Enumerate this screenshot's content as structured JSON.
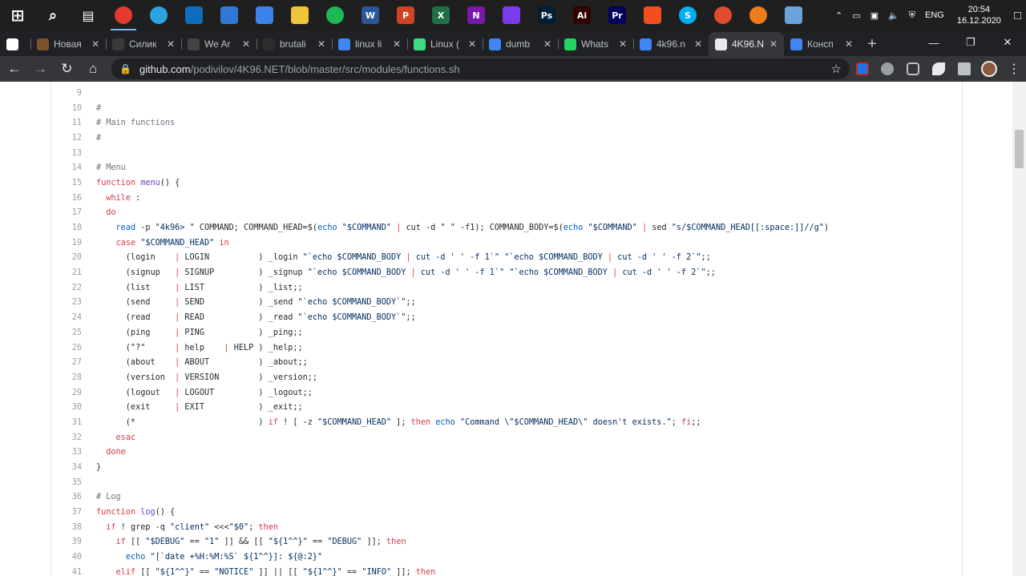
{
  "taskbar": {
    "icons": [
      {
        "name": "windows-start-icon",
        "label": "",
        "color": "#1f1f1f"
      },
      {
        "name": "search-icon",
        "label": "",
        "color": "#1f1f1f"
      },
      {
        "name": "task-view-icon",
        "label": "",
        "color": "#1f1f1f"
      },
      {
        "name": "chrome-icon",
        "label": "",
        "color": "#e33b2e",
        "active": true
      },
      {
        "name": "telegram-icon",
        "label": "",
        "color": "#2aa3df"
      },
      {
        "name": "outlook-icon",
        "label": "",
        "color": "#0f6cbd"
      },
      {
        "name": "calendar-icon",
        "label": "",
        "color": "#2f78d6"
      },
      {
        "name": "todo-icon",
        "label": "",
        "color": "#3c82e8"
      },
      {
        "name": "file-explorer-icon",
        "label": "",
        "color": "#f0c43a"
      },
      {
        "name": "spotify-icon",
        "label": "",
        "color": "#1db954"
      },
      {
        "name": "word-icon",
        "label": "W",
        "color": "#2b579a"
      },
      {
        "name": "powerpoint-icon",
        "label": "P",
        "color": "#d04423"
      },
      {
        "name": "excel-icon",
        "label": "X",
        "color": "#1e7145"
      },
      {
        "name": "onenote-icon",
        "label": "N",
        "color": "#7719aa"
      },
      {
        "name": "obsidian-icon",
        "label": "",
        "color": "#7c3aed"
      },
      {
        "name": "photoshop-icon",
        "label": "Ps",
        "color": "#001e36"
      },
      {
        "name": "illustrator-icon",
        "label": "Ai",
        "color": "#330000"
      },
      {
        "name": "premiere-icon",
        "label": "Pr",
        "color": "#00005b"
      },
      {
        "name": "figma-icon",
        "label": "",
        "color": "#f24e1e"
      },
      {
        "name": "skype-icon",
        "label": "S",
        "color": "#00aff0"
      },
      {
        "name": "app-icon",
        "label": "",
        "color": "#e04b2d"
      },
      {
        "name": "fl-studio-icon",
        "label": "",
        "color": "#f07b1a"
      },
      {
        "name": "notes-app-icon",
        "label": "",
        "color": "#6aa3d9"
      }
    ],
    "language": "ENG",
    "time": "20:54",
    "date": "16.12.2020"
  },
  "tabs": [
    {
      "title": "",
      "favicon": "#fff",
      "active": false
    },
    {
      "title": "Новая",
      "favicon": "#7a5230",
      "active": false
    },
    {
      "title": "Силик",
      "favicon": "#3a3a3a",
      "active": false
    },
    {
      "title": "We Ar",
      "favicon": "#444",
      "active": false
    },
    {
      "title": "brutali",
      "favicon": "#2d2d2d",
      "active": false
    },
    {
      "title": "linux li",
      "favicon": "#4285f4",
      "active": false
    },
    {
      "title": "Linux (",
      "favicon": "#3ddc84",
      "active": false
    },
    {
      "title": "dumb",
      "favicon": "#4285f4",
      "active": false
    },
    {
      "title": "Whats",
      "favicon": "#25d366",
      "active": false
    },
    {
      "title": "4k96.n",
      "favicon": "#4285f4",
      "active": false
    },
    {
      "title": "4K96.N",
      "favicon": "#e8eaed",
      "active": true
    },
    {
      "title": "Консп",
      "favicon": "#4285f4",
      "active": false
    }
  ],
  "omnibox": {
    "host": "github.com",
    "path": "/podivilov/4K96.NET/blob/master/src/modules/functions.sh"
  },
  "code": {
    "lines": [
      {
        "n": "9",
        "t": []
      },
      {
        "n": "10",
        "t": [
          [
            "c",
            "#"
          ]
        ]
      },
      {
        "n": "11",
        "t": [
          [
            "c",
            "# Main functions"
          ]
        ]
      },
      {
        "n": "12",
        "t": [
          [
            "c",
            "#"
          ]
        ]
      },
      {
        "n": "13",
        "t": []
      },
      {
        "n": "14",
        "t": [
          [
            "c",
            "# Menu"
          ]
        ]
      },
      {
        "n": "15",
        "t": [
          [
            "k",
            "function"
          ],
          [
            "",
            " "
          ],
          [
            "f",
            "menu"
          ],
          [
            "",
            "() {"
          ]
        ]
      },
      {
        "n": "16",
        "t": [
          [
            "",
            "  "
          ],
          [
            "k",
            "while"
          ],
          [
            "",
            " :"
          ]
        ]
      },
      {
        "n": "17",
        "t": [
          [
            "",
            "  "
          ],
          [
            "k",
            "do"
          ]
        ]
      },
      {
        "n": "18",
        "t": [
          [
            "",
            "    "
          ],
          [
            "b",
            "read"
          ],
          [
            "",
            " -p "
          ],
          [
            "s",
            "\"4k96> \" "
          ],
          [
            "",
            "COMMAND; COMMAND_HEAD=$("
          ],
          [
            "b",
            "echo"
          ],
          [
            "",
            " "
          ],
          [
            "s",
            "\"$COMMAND\""
          ],
          [
            "",
            " "
          ],
          [
            "k",
            "|"
          ],
          [
            "",
            " cut -d "
          ],
          [
            "s",
            "\" \""
          ],
          [
            "",
            " -f1); COMMAND_BODY=$("
          ],
          [
            "b",
            "echo"
          ],
          [
            "",
            " "
          ],
          [
            "s",
            "\"$COMMAND\""
          ],
          [
            "",
            " "
          ],
          [
            "k",
            "|"
          ],
          [
            "",
            " sed "
          ],
          [
            "s",
            "\"s/$COMMAND_HEAD[[:space:]]//g\""
          ],
          [
            "",
            ")"
          ]
        ]
      },
      {
        "n": "19",
        "t": [
          [
            "",
            "    "
          ],
          [
            "k",
            "case"
          ],
          [
            "",
            " "
          ],
          [
            "s",
            "\"$COMMAND_HEAD\""
          ],
          [
            "",
            " "
          ],
          [
            "k",
            "in"
          ]
        ]
      },
      {
        "n": "20",
        "t": [
          [
            "",
            "      (login    "
          ],
          [
            "k",
            "|"
          ],
          [
            "",
            " LOGIN          ) _login "
          ],
          [
            "s",
            "\"`echo $COMMAND_BODY "
          ],
          [
            "k",
            "|"
          ],
          [
            "s",
            " cut -d ' ' -f 1`\" \"`echo $COMMAND_BODY "
          ],
          [
            "k",
            "|"
          ],
          [
            "s",
            " cut -d ' ' -f 2`\""
          ],
          [
            "",
            ";;"
          ]
        ]
      },
      {
        "n": "21",
        "t": [
          [
            "",
            "      (signup   "
          ],
          [
            "k",
            "|"
          ],
          [
            "",
            " SIGNUP         ) _signup "
          ],
          [
            "s",
            "\"`echo $COMMAND_BODY "
          ],
          [
            "k",
            "|"
          ],
          [
            "s",
            " cut -d ' ' -f 1`\" \"`echo $COMMAND_BODY "
          ],
          [
            "k",
            "|"
          ],
          [
            "s",
            " cut -d ' ' -f 2`\""
          ],
          [
            "",
            ";;"
          ]
        ]
      },
      {
        "n": "22",
        "t": [
          [
            "",
            "      (list     "
          ],
          [
            "k",
            "|"
          ],
          [
            "",
            " LIST           ) _list;;"
          ]
        ]
      },
      {
        "n": "23",
        "t": [
          [
            "",
            "      (send     "
          ],
          [
            "k",
            "|"
          ],
          [
            "",
            " SEND           ) _send "
          ],
          [
            "s",
            "\"`echo $COMMAND_BODY`\""
          ],
          [
            "",
            ";;"
          ]
        ]
      },
      {
        "n": "24",
        "t": [
          [
            "",
            "      (read     "
          ],
          [
            "k",
            "|"
          ],
          [
            "",
            " READ           ) _read "
          ],
          [
            "s",
            "\"`echo $COMMAND_BODY`\""
          ],
          [
            "",
            ";;"
          ]
        ]
      },
      {
        "n": "25",
        "t": [
          [
            "",
            "      (ping     "
          ],
          [
            "k",
            "|"
          ],
          [
            "",
            " PING           ) _ping;;"
          ]
        ]
      },
      {
        "n": "26",
        "t": [
          [
            "",
            "      (\"?\"      "
          ],
          [
            "k",
            "|"
          ],
          [
            "",
            " help    "
          ],
          [
            "k",
            "|"
          ],
          [
            "",
            " HELP ) _help;;"
          ]
        ]
      },
      {
        "n": "27",
        "t": [
          [
            "",
            "      (about    "
          ],
          [
            "k",
            "|"
          ],
          [
            "",
            " ABOUT          ) _about;;"
          ]
        ]
      },
      {
        "n": "28",
        "t": [
          [
            "",
            "      (version  "
          ],
          [
            "k",
            "|"
          ],
          [
            "",
            " VERSION        ) _version;;"
          ]
        ]
      },
      {
        "n": "29",
        "t": [
          [
            "",
            "      (logout   "
          ],
          [
            "k",
            "|"
          ],
          [
            "",
            " LOGOUT         ) _logout;;"
          ]
        ]
      },
      {
        "n": "30",
        "t": [
          [
            "",
            "      (exit     "
          ],
          [
            "k",
            "|"
          ],
          [
            "",
            " EXIT           ) _exit;;"
          ]
        ]
      },
      {
        "n": "31",
        "t": [
          [
            "",
            "      (*                         ) "
          ],
          [
            "k",
            "if"
          ],
          [
            "",
            " ! [ -z "
          ],
          [
            "s",
            "\"$COMMAND_HEAD\""
          ],
          [
            "",
            " ]; "
          ],
          [
            "k",
            "then"
          ],
          [
            "",
            " "
          ],
          [
            "b",
            "echo"
          ],
          [
            "",
            " "
          ],
          [
            "s",
            "\"Command \\\"$COMMAND_HEAD\\\" doesn't exists.\""
          ],
          [
            "",
            "; "
          ],
          [
            "k",
            "fi"
          ],
          [
            "",
            ";;"
          ]
        ]
      },
      {
        "n": "32",
        "t": [
          [
            "",
            "    "
          ],
          [
            "k",
            "esac"
          ]
        ]
      },
      {
        "n": "33",
        "t": [
          [
            "",
            "  "
          ],
          [
            "k",
            "done"
          ]
        ]
      },
      {
        "n": "34",
        "t": [
          [
            "",
            "}"
          ]
        ]
      },
      {
        "n": "35",
        "t": []
      },
      {
        "n": "36",
        "t": [
          [
            "c",
            "# Log"
          ]
        ]
      },
      {
        "n": "37",
        "t": [
          [
            "k",
            "function"
          ],
          [
            "",
            " "
          ],
          [
            "f",
            "log"
          ],
          [
            "",
            "() {"
          ]
        ]
      },
      {
        "n": "38",
        "t": [
          [
            "",
            "  "
          ],
          [
            "k",
            "if"
          ],
          [
            "",
            " ! grep -q "
          ],
          [
            "s",
            "\"client\""
          ],
          [
            "",
            " <<<"
          ],
          [
            "s",
            "\"$0\""
          ],
          [
            "",
            "; "
          ],
          [
            "k",
            "then"
          ]
        ]
      },
      {
        "n": "39",
        "t": [
          [
            "",
            "    "
          ],
          [
            "k",
            "if"
          ],
          [
            "",
            " [[ "
          ],
          [
            "s",
            "\"$DEBUG\""
          ],
          [
            "",
            " == "
          ],
          [
            "s",
            "\"1\""
          ],
          [
            "",
            " ]] && [[ "
          ],
          [
            "s",
            "\"${1^^}\""
          ],
          [
            "",
            " == "
          ],
          [
            "s",
            "\"DEBUG\""
          ],
          [
            "",
            " ]]; "
          ],
          [
            "k",
            "then"
          ]
        ]
      },
      {
        "n": "40",
        "t": [
          [
            "",
            "      "
          ],
          [
            "b",
            "echo"
          ],
          [
            "",
            " "
          ],
          [
            "s",
            "\"[`date +%H:%M:%S` ${1^^}]: ${@:2}\""
          ]
        ]
      },
      {
        "n": "41",
        "t": [
          [
            "",
            "    "
          ],
          [
            "k",
            "elif"
          ],
          [
            "",
            " [[ "
          ],
          [
            "s",
            "\"${1^^}\""
          ],
          [
            "",
            " == "
          ],
          [
            "s",
            "\"NOTICE\""
          ],
          [
            "",
            " ]] || [[ "
          ],
          [
            "s",
            "\"${1^^}\""
          ],
          [
            "",
            " == "
          ],
          [
            "s",
            "\"INFO\""
          ],
          [
            "",
            " ]]; "
          ],
          [
            "k",
            "then"
          ]
        ]
      }
    ]
  }
}
